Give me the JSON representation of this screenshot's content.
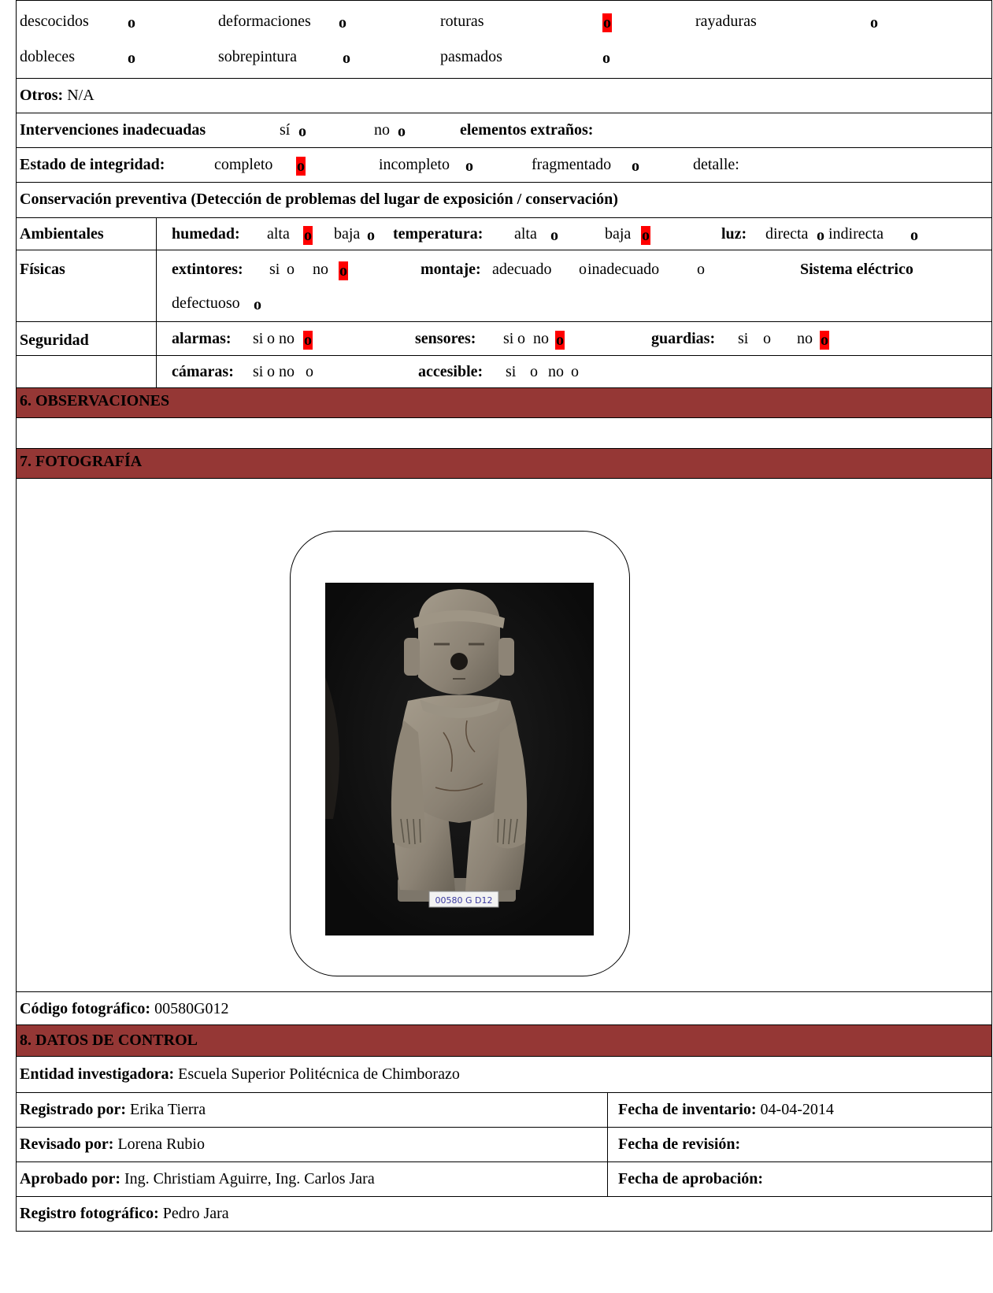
{
  "damage": {
    "descocidos": "descocidos",
    "deformaciones": "deformaciones",
    "roturas": "roturas",
    "rayaduras": "rayaduras",
    "dobleces": "dobleces",
    "sobrepintura": "sobrepintura",
    "pasmados": "pasmados",
    "mark": "o"
  },
  "otros": {
    "label": "Otros:",
    "value": "N/A"
  },
  "intervenciones": {
    "label": "Intervenciones inadecuadas",
    "si": "sí",
    "no": "no",
    "extranos_label": "elementos extraños:"
  },
  "integridad": {
    "label": "Estado de integridad:",
    "completo": "completo",
    "incompleto": "incompleto",
    "fragmentado": "fragmentado",
    "detalle": "detalle:"
  },
  "conservacion": {
    "heading": "Conservación preventiva (Detección de problemas del lugar de exposición / conservación)"
  },
  "ambientales": {
    "label": "Ambientales",
    "humedad_label": "humedad:",
    "alta": "alta",
    "baja": "baja",
    "temperatura_label": "temperatura:",
    "luz_label": "luz:",
    "directa": "directa",
    "indirecta": "indirecta"
  },
  "fisicas": {
    "label": "Físicas",
    "extintores_label": "extintores:",
    "si": "si",
    "no": "no",
    "montaje_label": "montaje:",
    "adecuado": "adecuado",
    "inadecuado": "inadecuado",
    "sistema_label": "Sistema eléctrico",
    "defectuoso": "defectuoso"
  },
  "seguridad": {
    "label": "Seguridad",
    "alarmas_label": "alarmas:",
    "sensores_label": "sensores:",
    "guardias_label": "guardias:",
    "camaras_label": "cámaras:",
    "accesible_label": "accesible:",
    "si": "si",
    "no": "no"
  },
  "sections": {
    "observaciones": "6. OBSERVACIONES",
    "fotografia": "7. FOTOGRAFÍA",
    "control": "8. DATOS DE CONTROL"
  },
  "photo": {
    "tag_text": "00580 G D12"
  },
  "codigo": {
    "label": "Código fotográfico:",
    "value": "00580G012"
  },
  "control": {
    "entidad_label": "Entidad investigadora:",
    "entidad_value": "Escuela Superior Politécnica de Chimborazo",
    "registrado_label": "Registrado por:",
    "registrado_value": "Erika Tierra",
    "fecha_inv_label": "Fecha de inventario:",
    "fecha_inv_value": "04-04-2014",
    "revisado_label": "Revisado por:",
    "revisado_value": "Lorena Rubio",
    "fecha_rev_label": "Fecha de revisión:",
    "aprobado_label": "Aprobado por:",
    "aprobado_value": "Ing. Christiam Aguirre, Ing. Carlos Jara",
    "fecha_apr_label": "Fecha de aprobación:",
    "registro_label": "Registro fotográfico:",
    "registro_value": "Pedro Jara"
  },
  "colors": {
    "section_bg": "#953735",
    "mark_bg": "#ff0000"
  }
}
